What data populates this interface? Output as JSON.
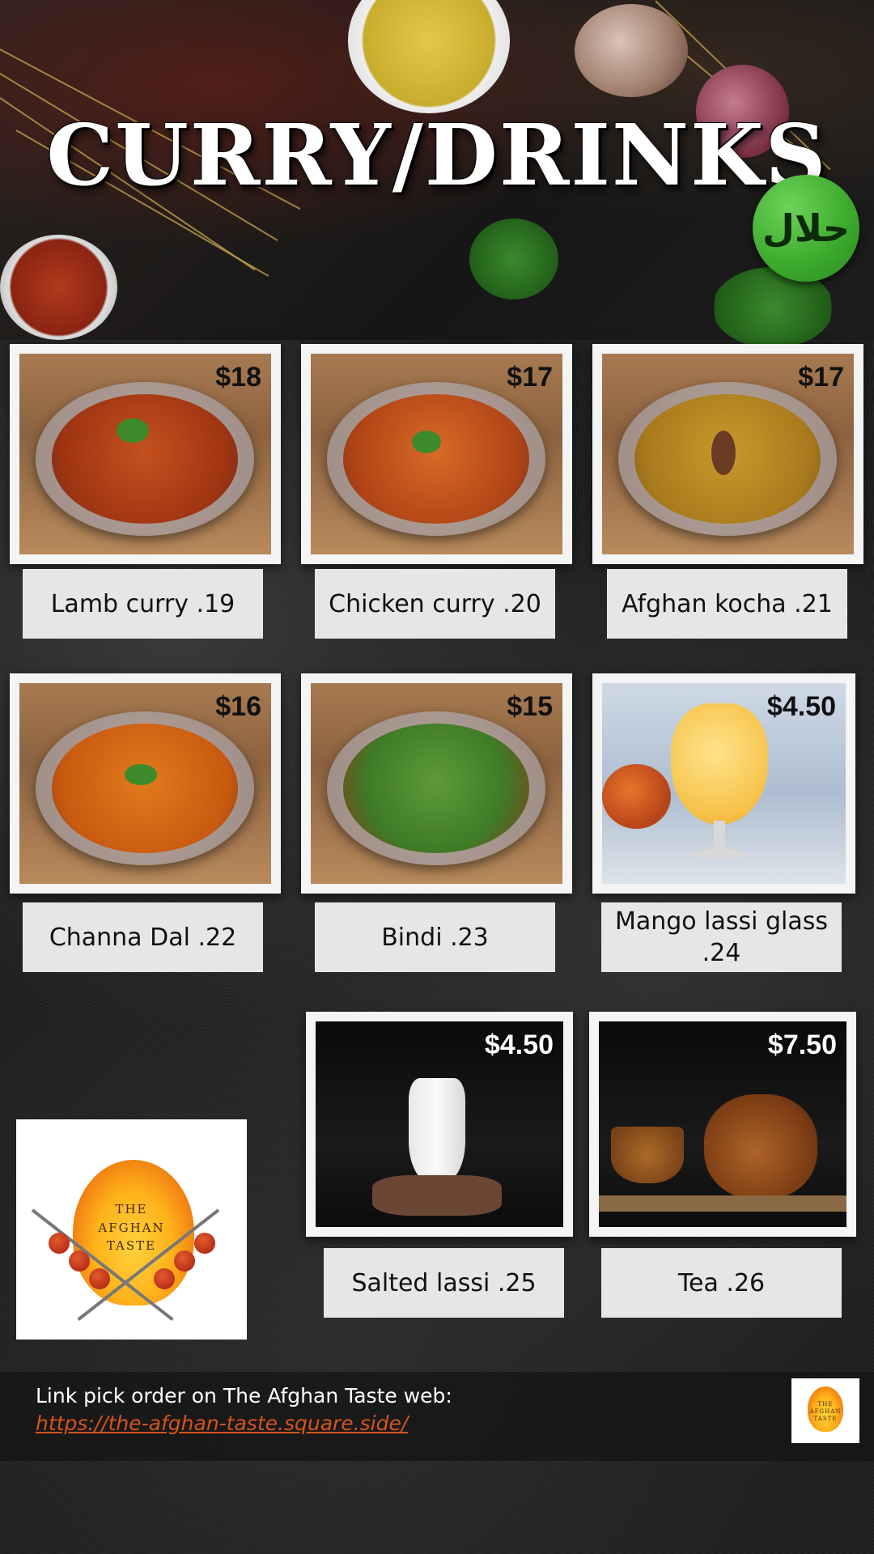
{
  "header": {
    "title": "CURRY/DRINKS",
    "halal_badge": "حلال"
  },
  "menu_items": [
    {
      "name": "Lamb curry .19",
      "price": "$18"
    },
    {
      "name": "Chicken curry .20",
      "price": "$17"
    },
    {
      "name": "Afghan kocha .21",
      "price": "$17"
    },
    {
      "name": "Channa Dal .22",
      "price": "$16"
    },
    {
      "name": "Bindi .23",
      "price": "$15"
    },
    {
      "name": "Mango lassi glass .24",
      "price": "$4.50"
    },
    {
      "name": "Salted lassi .25",
      "price": "$4.50"
    },
    {
      "name": "Tea .26",
      "price": "$7.50"
    }
  ],
  "logo": {
    "line1": "THE",
    "line2": "AFGHAN",
    "line3": "TASTE"
  },
  "footer": {
    "text": "Link pick order on The Afghan Taste web:",
    "link": "https://the-afghan-taste.square.side/"
  },
  "colors": {
    "halal_green": "#3eab2f",
    "link_orange": "#d4541c",
    "label_bg": "#e6e6e6"
  }
}
